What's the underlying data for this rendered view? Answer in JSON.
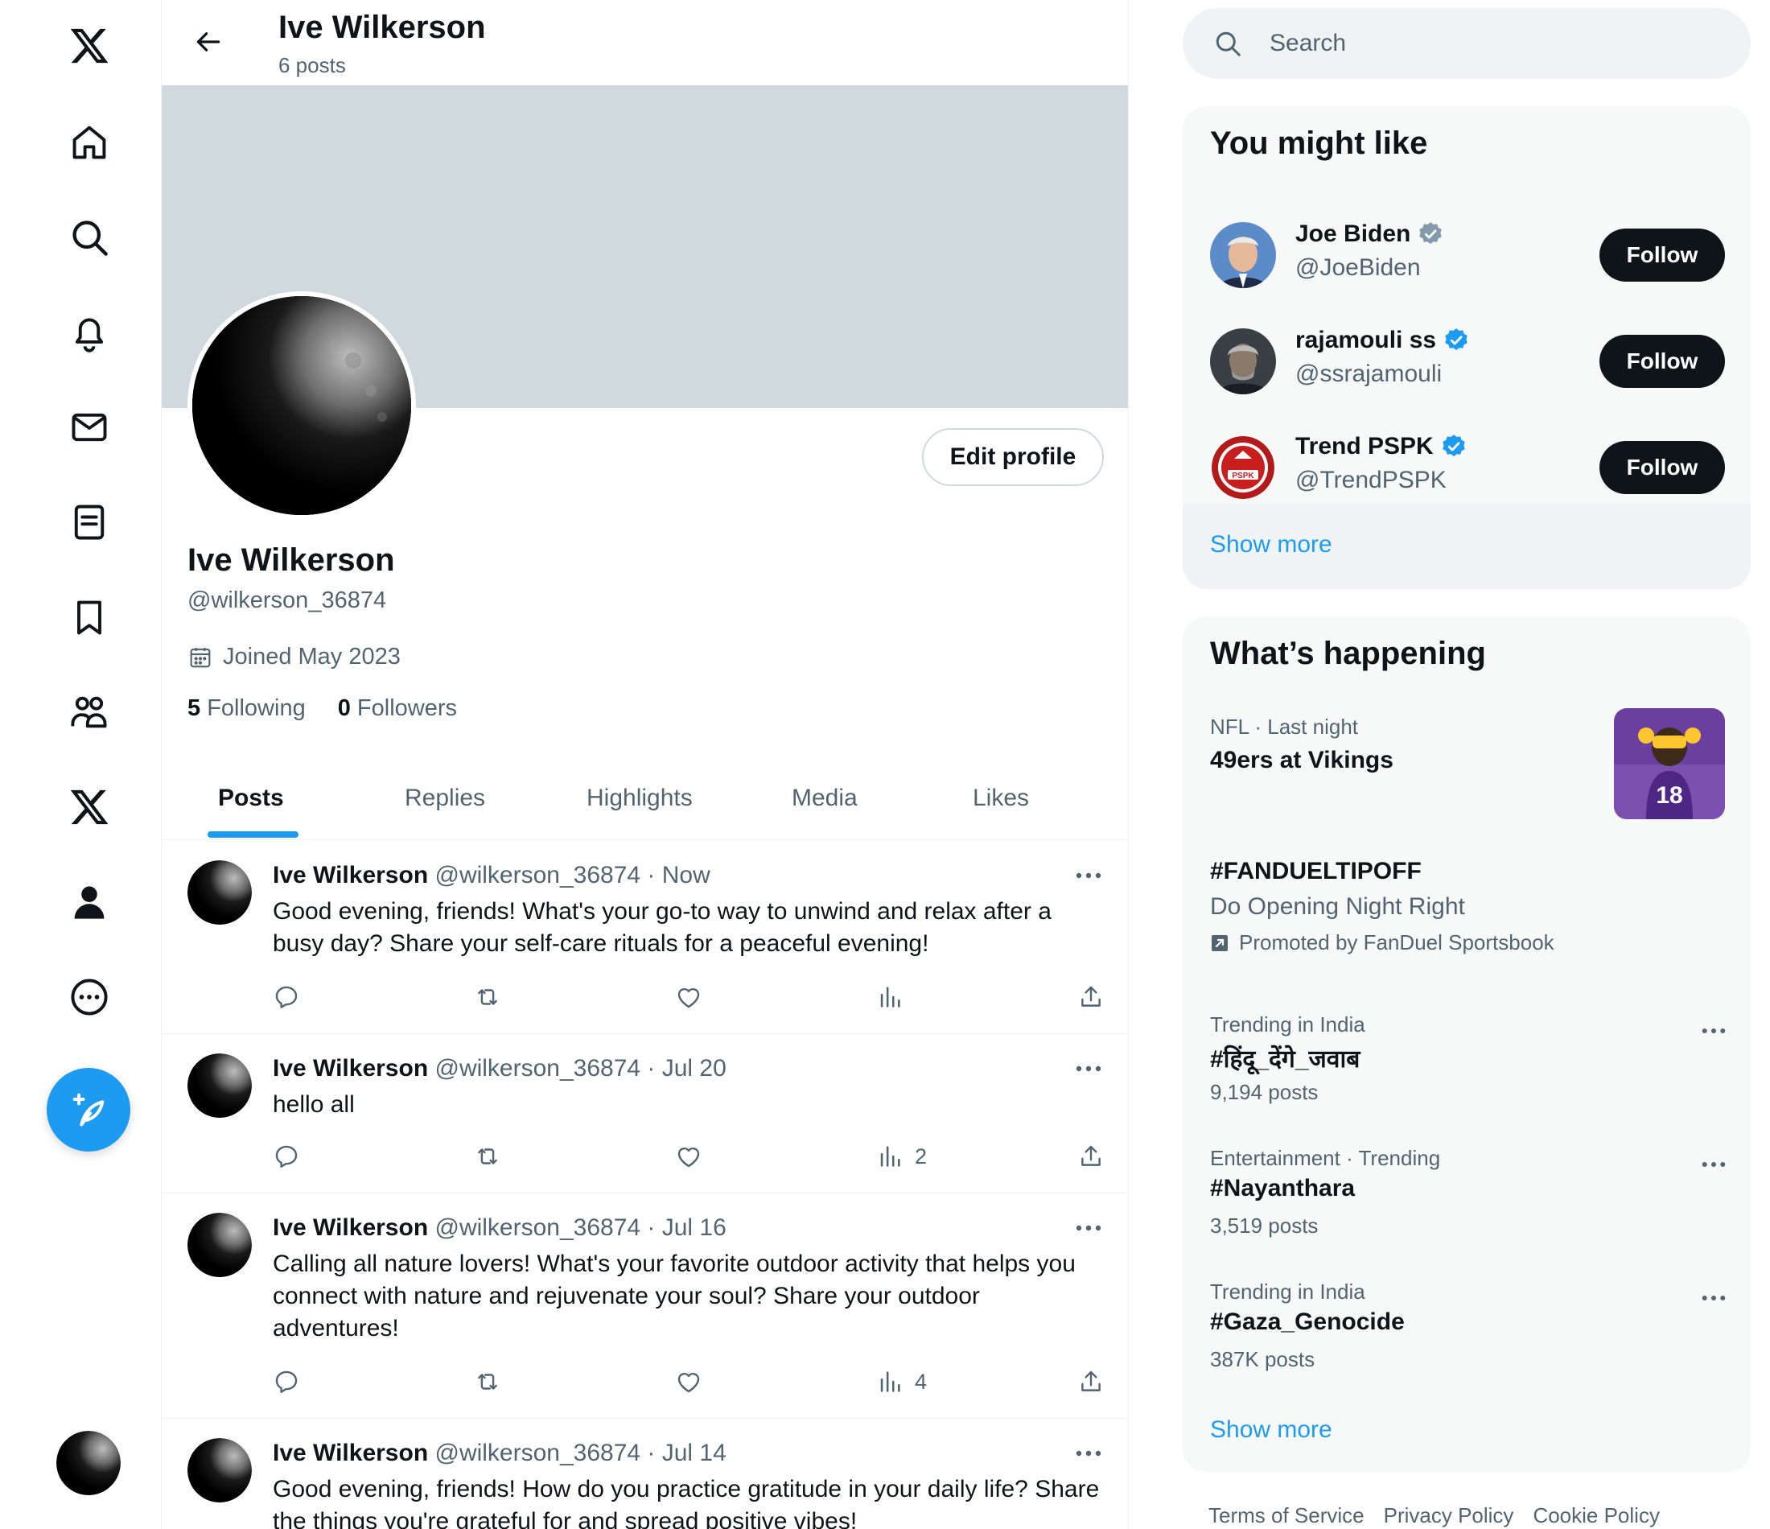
{
  "header": {
    "name": "Ive Wilkerson",
    "post_count": "6 posts"
  },
  "profile": {
    "name": "Ive Wilkerson",
    "handle": "@wilkerson_36874",
    "joined": "Joined May 2023",
    "following_count": "5",
    "following_label": "Following",
    "followers_count": "0",
    "followers_label": "Followers",
    "edit_label": "Edit profile"
  },
  "tabs": [
    "Posts",
    "Replies",
    "Highlights",
    "Media",
    "Likes"
  ],
  "active_tab": "Posts",
  "posts": [
    {
      "name": "Ive Wilkerson",
      "meta": "@wilkerson_36874 · Now",
      "text": "Good evening, friends! What's your go-to way to unwind and relax after a busy day? Share your self-care rituals for a peaceful evening!",
      "views": ""
    },
    {
      "name": "Ive Wilkerson",
      "meta": "@wilkerson_36874 · Jul 20",
      "text": "hello all",
      "views": "2"
    },
    {
      "name": "Ive Wilkerson",
      "meta": "@wilkerson_36874 · Jul 16",
      "text": "Calling all nature lovers! What's your favorite outdoor activity that helps you connect with nature and rejuvenate your soul? Share your outdoor adventures!",
      "views": "4"
    },
    {
      "name": "Ive Wilkerson",
      "meta": "@wilkerson_36874 · Jul 14",
      "text": "Good evening, friends! How do you practice gratitude in your daily life? Share the things you're grateful for and spread positive vibes!",
      "views": ""
    }
  ],
  "search": {
    "placeholder": "Search"
  },
  "suggestions": {
    "title": "You might like",
    "follow_label": "Follow",
    "show_more": "Show more",
    "items": [
      {
        "name": "Joe Biden",
        "handle": "@JoeBiden",
        "badge_color": "#829aab"
      },
      {
        "name": "rajamouli ss",
        "handle": "@ssrajamouli",
        "badge_color": "#1d9bf0"
      },
      {
        "name": "Trend PSPK",
        "handle": "@TrendPSPK",
        "badge_color": "#1d9bf0"
      }
    ]
  },
  "trends": {
    "title": "What’s happening",
    "show_more": "Show more",
    "featured": {
      "meta": "NFL · Last night",
      "title": "49ers at Vikings",
      "image_label": "18"
    },
    "promoted": {
      "title": "#FANDUELTIPOFF",
      "subtitle": "Do Opening Night Right",
      "promo": "Promoted by FanDuel Sportsbook"
    },
    "items": [
      {
        "meta": "Trending in India",
        "title": "#हिंदू_देंगे_जवाब",
        "count": "9,194 posts"
      },
      {
        "meta": "Entertainment · Trending",
        "title": "#Nayanthara",
        "count": "3,519 posts"
      },
      {
        "meta": "Trending in India",
        "title": "#Gaza_Genocide",
        "count": "387K posts"
      }
    ]
  },
  "footer": [
    "Terms of Service",
    "Privacy Policy",
    "Cookie Policy"
  ],
  "colors": {
    "accent": "#1d9bf0",
    "text": "#0f1419",
    "muted": "#536471",
    "banner": "#cfd9de"
  }
}
